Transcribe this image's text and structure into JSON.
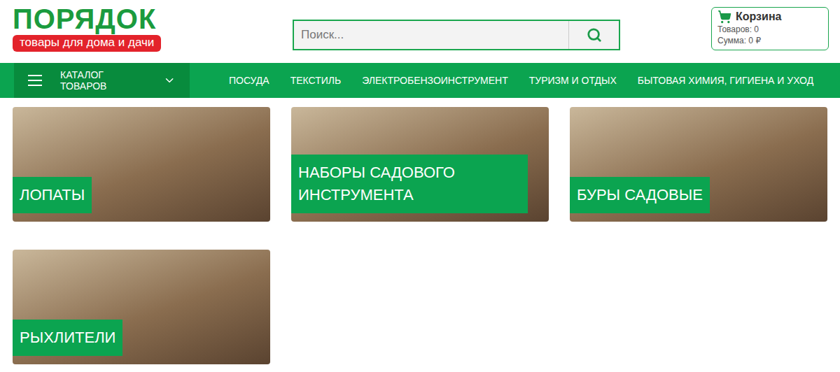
{
  "logo": {
    "title": "ПОРЯДОК",
    "subtitle": "товары для дома и дачи"
  },
  "search": {
    "placeholder": "Поиск..."
  },
  "cart": {
    "title": "Корзина",
    "items": "Товаров: 0",
    "sum": "Сумма: 0 ₽"
  },
  "nav": {
    "catalog": "КАТАЛОГ ТОВАРОВ",
    "items": [
      "ПОСУДА",
      "ТЕКСТИЛЬ",
      "ЭЛЕКТРОБЕНЗОИНСТРУМЕНТ",
      "ТУРИЗМ И ОТДЫХ",
      "БЫТОВАЯ ХИМИЯ, ГИГИЕНА И УХОД"
    ]
  },
  "categories": [
    {
      "name": "ЛОПАТЫ"
    },
    {
      "name": "НАБОРЫ САДОВОГО ИНСТРУМЕНТА"
    },
    {
      "name": "БУРЫ САДОВЫЕ"
    },
    {
      "name": "РЫХЛИТЕЛИ"
    }
  ]
}
